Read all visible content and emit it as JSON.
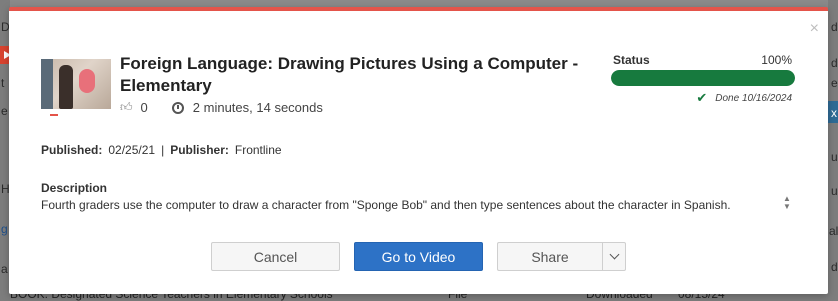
{
  "background": {
    "left_frags": [
      "D",
      "t",
      "e",
      "H",
      "g",
      "a",
      "l"
    ],
    "right_frags": [
      "d",
      "d",
      "e",
      "x",
      "u",
      "u",
      "al",
      "d"
    ],
    "bottom_row": [
      "BOOK: Designated Science Teachers in Elementary Schools",
      "File",
      "Downloaded",
      "08/15/24"
    ]
  },
  "modal": {
    "close_symbol": "×",
    "title": "Foreign Language: Drawing Pictures Using a Computer - Elementary",
    "likes": "0",
    "duration": "2 minutes, 14 seconds",
    "status": {
      "label": "Status",
      "percent_text": "100%",
      "progress": 100,
      "done_text": "Done 10/16/2024"
    },
    "published_label": "Published:",
    "published_value": "02/25/21",
    "separator": "|",
    "publisher_label": "Publisher:",
    "publisher_value": "Frontline",
    "description_label": "Description",
    "description_text": "Fourth graders use the computer to draw a character from \"Sponge Bob\" and then type sentences about the character in Spanish.",
    "buttons": {
      "cancel": "Cancel",
      "go": "Go to Video",
      "share": "Share"
    }
  },
  "colors": {
    "accent_top": "#e4544a",
    "progress_green": "#177a3e",
    "primary_blue": "#2d72c6"
  }
}
